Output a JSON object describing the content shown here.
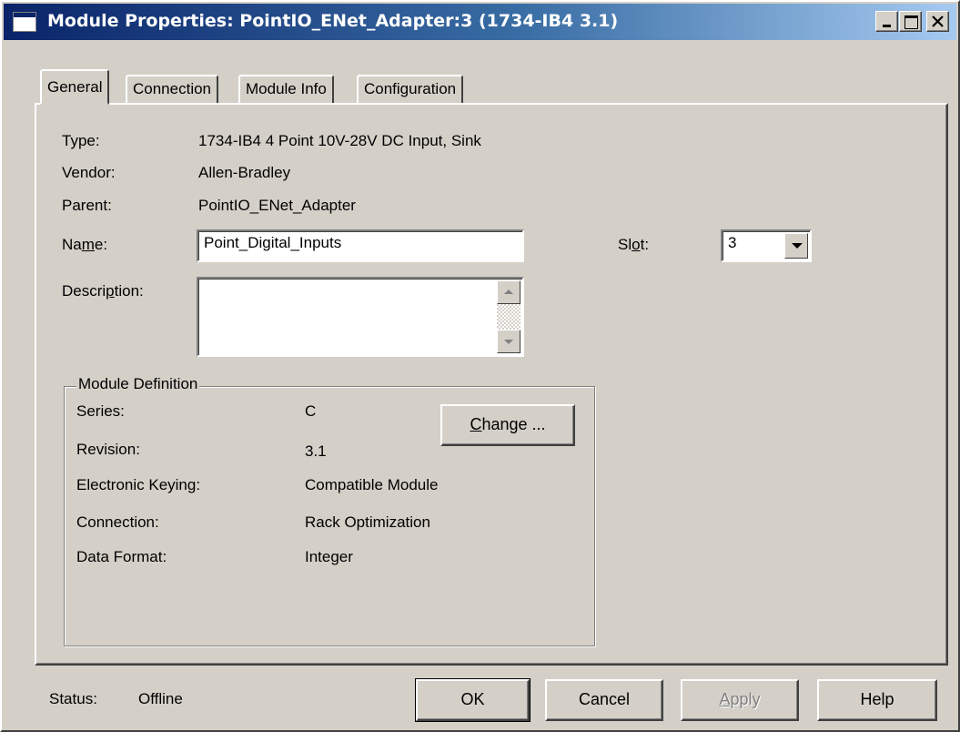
{
  "window": {
    "title": "Module Properties: PointIO_ENet_Adapter:3 (1734-IB4 3.1)"
  },
  "tabs": [
    {
      "label": "General",
      "active": true
    },
    {
      "label": "Connection",
      "active": false
    },
    {
      "label": "Module Info",
      "active": false
    },
    {
      "label": "Configuration",
      "active": false
    }
  ],
  "general": {
    "type_label": "Type:",
    "type_value": "1734-IB4 4 Point 10V-28V DC Input, Sink",
    "vendor_label": "Vendor:",
    "vendor_value": "Allen-Bradley",
    "parent_label": "Parent:",
    "parent_value": "PointIO_ENet_Adapter",
    "name_label_pre": "Na",
    "name_label_u": "m",
    "name_label_post": "e:",
    "name_value": "Point_Digital_Inputs",
    "slot_label_pre": "Sl",
    "slot_label_u": "o",
    "slot_label_post": "t:",
    "slot_value": "3",
    "description_label_pre": "Descri",
    "description_label_u": "p",
    "description_label_post": "tion:",
    "description_value": ""
  },
  "module_definition": {
    "legend": "Module Definition",
    "series_label": "Series:",
    "series_value": "C",
    "revision_label": "Revision:",
    "revision_value": "3.1",
    "keying_label": "Electronic Keying:",
    "keying_value": "Compatible Module",
    "connection_label": "Connection:",
    "connection_value": "Rack Optimization",
    "format_label": "Data Format:",
    "format_value": "Integer",
    "change_button_u": "C",
    "change_button_rest": "hange ..."
  },
  "footer": {
    "status_label": "Status:",
    "status_value": "Offline",
    "ok_label": "OK",
    "cancel_label": "Cancel",
    "apply_label_u": "A",
    "apply_label_rest": "pply",
    "help_label": "Help"
  },
  "colors": {
    "face": "#d4d0c8",
    "title_start": "#0a246a",
    "title_end": "#a6caf0"
  }
}
